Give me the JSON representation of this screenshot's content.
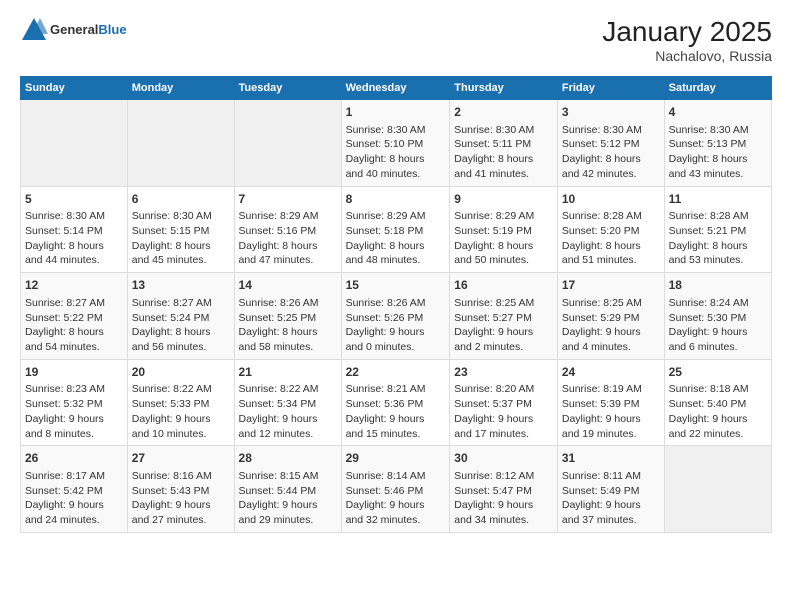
{
  "header": {
    "logo_general": "General",
    "logo_blue": "Blue",
    "month_title": "January 2025",
    "location": "Nachalovo, Russia"
  },
  "weekdays": [
    "Sunday",
    "Monday",
    "Tuesday",
    "Wednesday",
    "Thursday",
    "Friday",
    "Saturday"
  ],
  "weeks": [
    [
      {
        "day": "",
        "content": ""
      },
      {
        "day": "",
        "content": ""
      },
      {
        "day": "",
        "content": ""
      },
      {
        "day": "1",
        "content": "Sunrise: 8:30 AM\nSunset: 5:10 PM\nDaylight: 8 hours\nand 40 minutes."
      },
      {
        "day": "2",
        "content": "Sunrise: 8:30 AM\nSunset: 5:11 PM\nDaylight: 8 hours\nand 41 minutes."
      },
      {
        "day": "3",
        "content": "Sunrise: 8:30 AM\nSunset: 5:12 PM\nDaylight: 8 hours\nand 42 minutes."
      },
      {
        "day": "4",
        "content": "Sunrise: 8:30 AM\nSunset: 5:13 PM\nDaylight: 8 hours\nand 43 minutes."
      }
    ],
    [
      {
        "day": "5",
        "content": "Sunrise: 8:30 AM\nSunset: 5:14 PM\nDaylight: 8 hours\nand 44 minutes."
      },
      {
        "day": "6",
        "content": "Sunrise: 8:30 AM\nSunset: 5:15 PM\nDaylight: 8 hours\nand 45 minutes."
      },
      {
        "day": "7",
        "content": "Sunrise: 8:29 AM\nSunset: 5:16 PM\nDaylight: 8 hours\nand 47 minutes."
      },
      {
        "day": "8",
        "content": "Sunrise: 8:29 AM\nSunset: 5:18 PM\nDaylight: 8 hours\nand 48 minutes."
      },
      {
        "day": "9",
        "content": "Sunrise: 8:29 AM\nSunset: 5:19 PM\nDaylight: 8 hours\nand 50 minutes."
      },
      {
        "day": "10",
        "content": "Sunrise: 8:28 AM\nSunset: 5:20 PM\nDaylight: 8 hours\nand 51 minutes."
      },
      {
        "day": "11",
        "content": "Sunrise: 8:28 AM\nSunset: 5:21 PM\nDaylight: 8 hours\nand 53 minutes."
      }
    ],
    [
      {
        "day": "12",
        "content": "Sunrise: 8:27 AM\nSunset: 5:22 PM\nDaylight: 8 hours\nand 54 minutes."
      },
      {
        "day": "13",
        "content": "Sunrise: 8:27 AM\nSunset: 5:24 PM\nDaylight: 8 hours\nand 56 minutes."
      },
      {
        "day": "14",
        "content": "Sunrise: 8:26 AM\nSunset: 5:25 PM\nDaylight: 8 hours\nand 58 minutes."
      },
      {
        "day": "15",
        "content": "Sunrise: 8:26 AM\nSunset: 5:26 PM\nDaylight: 9 hours\nand 0 minutes."
      },
      {
        "day": "16",
        "content": "Sunrise: 8:25 AM\nSunset: 5:27 PM\nDaylight: 9 hours\nand 2 minutes."
      },
      {
        "day": "17",
        "content": "Sunrise: 8:25 AM\nSunset: 5:29 PM\nDaylight: 9 hours\nand 4 minutes."
      },
      {
        "day": "18",
        "content": "Sunrise: 8:24 AM\nSunset: 5:30 PM\nDaylight: 9 hours\nand 6 minutes."
      }
    ],
    [
      {
        "day": "19",
        "content": "Sunrise: 8:23 AM\nSunset: 5:32 PM\nDaylight: 9 hours\nand 8 minutes."
      },
      {
        "day": "20",
        "content": "Sunrise: 8:22 AM\nSunset: 5:33 PM\nDaylight: 9 hours\nand 10 minutes."
      },
      {
        "day": "21",
        "content": "Sunrise: 8:22 AM\nSunset: 5:34 PM\nDaylight: 9 hours\nand 12 minutes."
      },
      {
        "day": "22",
        "content": "Sunrise: 8:21 AM\nSunset: 5:36 PM\nDaylight: 9 hours\nand 15 minutes."
      },
      {
        "day": "23",
        "content": "Sunrise: 8:20 AM\nSunset: 5:37 PM\nDaylight: 9 hours\nand 17 minutes."
      },
      {
        "day": "24",
        "content": "Sunrise: 8:19 AM\nSunset: 5:39 PM\nDaylight: 9 hours\nand 19 minutes."
      },
      {
        "day": "25",
        "content": "Sunrise: 8:18 AM\nSunset: 5:40 PM\nDaylight: 9 hours\nand 22 minutes."
      }
    ],
    [
      {
        "day": "26",
        "content": "Sunrise: 8:17 AM\nSunset: 5:42 PM\nDaylight: 9 hours\nand 24 minutes."
      },
      {
        "day": "27",
        "content": "Sunrise: 8:16 AM\nSunset: 5:43 PM\nDaylight: 9 hours\nand 27 minutes."
      },
      {
        "day": "28",
        "content": "Sunrise: 8:15 AM\nSunset: 5:44 PM\nDaylight: 9 hours\nand 29 minutes."
      },
      {
        "day": "29",
        "content": "Sunrise: 8:14 AM\nSunset: 5:46 PM\nDaylight: 9 hours\nand 32 minutes."
      },
      {
        "day": "30",
        "content": "Sunrise: 8:12 AM\nSunset: 5:47 PM\nDaylight: 9 hours\nand 34 minutes."
      },
      {
        "day": "31",
        "content": "Sunrise: 8:11 AM\nSunset: 5:49 PM\nDaylight: 9 hours\nand 37 minutes."
      },
      {
        "day": "",
        "content": ""
      }
    ]
  ]
}
